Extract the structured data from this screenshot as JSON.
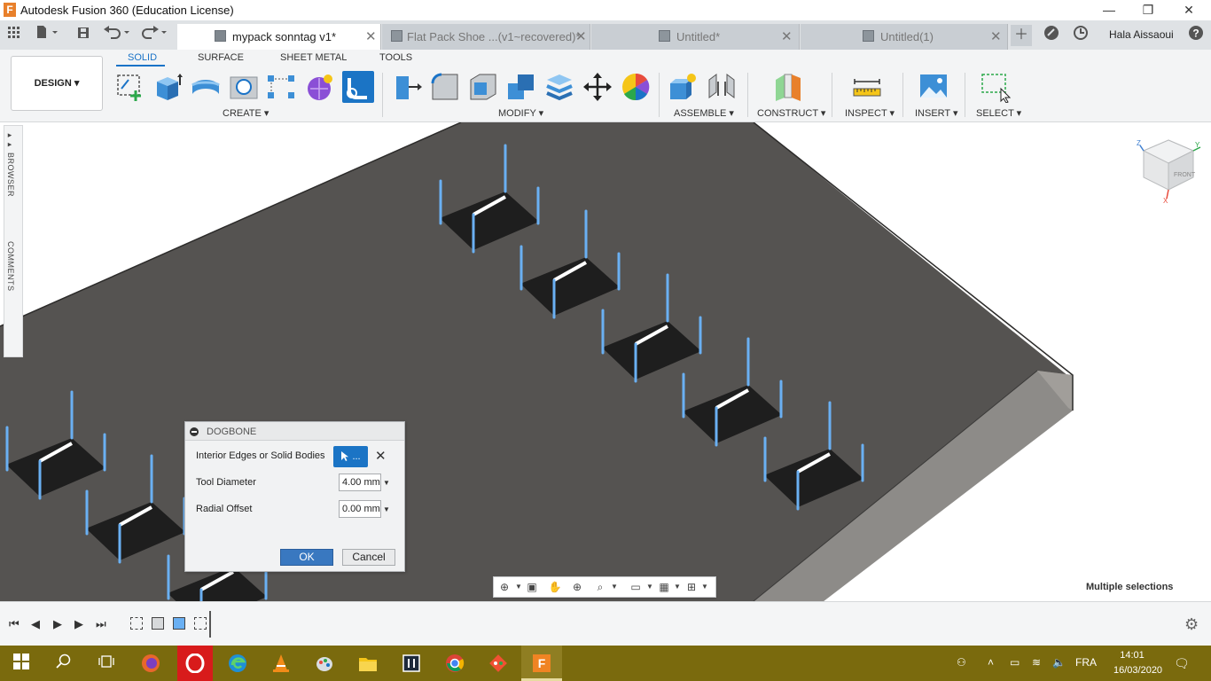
{
  "window": {
    "title": "Autodesk Fusion 360 (Education License)",
    "controls": {
      "minimize": "—",
      "restore": "❐",
      "close": "✕"
    }
  },
  "quick_access": [
    "grid-icon",
    "file-icon",
    "save-icon",
    "undo-icon",
    "redo-icon"
  ],
  "tabs": [
    {
      "label": "mypack sonntag v1*",
      "active": true
    },
    {
      "label": "Flat Pack Shoe ...(v1~recovered)*",
      "active": false
    },
    {
      "label": "Untitled*",
      "active": false
    },
    {
      "label": "Untitled(1)",
      "active": false
    }
  ],
  "user": {
    "name": "Hala Aissaoui"
  },
  "ribbon": {
    "workspace": "DESIGN",
    "tabs": [
      "SOLID",
      "SURFACE",
      "SHEET METAL",
      "TOOLS"
    ],
    "groups": [
      "CREATE",
      "MODIFY",
      "ASSEMBLE",
      "CONSTRUCT",
      "INSPECT",
      "INSERT",
      "SELECT"
    ]
  },
  "sidebar": {
    "browser": "BROWSER",
    "comments": "COMMENTS"
  },
  "dialog": {
    "title": "DOGBONE",
    "edges_label": "Interior Edges or Solid Bodies",
    "select_button": "...",
    "tool_diameter_label": "Tool Diameter",
    "tool_diameter_value": "4.00 mm",
    "radial_offset_label": "Radial Offset",
    "radial_offset_value": "0.00 mm",
    "ok": "OK",
    "cancel": "Cancel"
  },
  "status": {
    "selection": "Multiple selections"
  },
  "viewcube": {
    "axes": [
      "Z",
      "Y",
      "X"
    ],
    "face": "FRONT"
  },
  "taskbar": {
    "language": "FRA",
    "time": "14:01",
    "date": "16/03/2020",
    "accent": "#7a6a0d"
  },
  "colors": {
    "accent": "#1a73c7",
    "plate": "#555351",
    "edge_highlight": "#6ab0f3"
  }
}
